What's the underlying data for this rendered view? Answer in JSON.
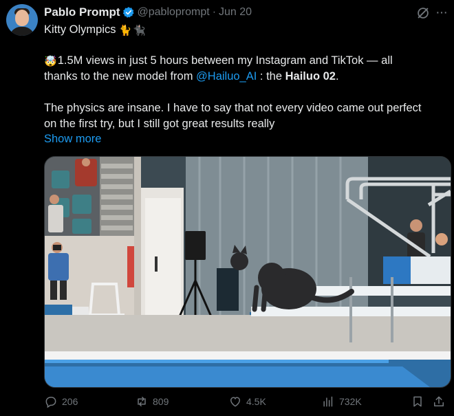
{
  "author": {
    "name": "Pablo Prompt",
    "handle": "@pabloprompt",
    "separator": "·",
    "date": "Jun 20"
  },
  "tweet": {
    "line1": "Kitty Olympics",
    "line2_emoji": "🤯",
    "line2": "1.5M views in just 5 hours between my Instagram and TikTok — all",
    "line3_a": "thanks to the new model from ",
    "line3_mention": "@Hailuo_AI",
    "line3_b": " : the ",
    "line3_bold": "Hailuo 02",
    "line3_c": ".",
    "line4": "The physics are insane. I have to say that not every video came out perfect",
    "line5": "on the first try, but I still got great results really",
    "show_more": "Show more"
  },
  "stats": {
    "replies": "206",
    "reposts": "809",
    "likes": "4.5K",
    "views": "732K"
  },
  "icons": {
    "verified": "verified-badge-icon",
    "grok": "grok-icon",
    "more": "more-icon",
    "reply": "reply-icon",
    "repost": "repost-icon",
    "like": "heart-icon",
    "views": "views-icon",
    "bookmark": "bookmark-icon",
    "share": "share-icon"
  },
  "colors": {
    "background": "#000000",
    "text": "#e7e9ea",
    "secondary": "#71767b",
    "accent": "#1d9bf0"
  }
}
